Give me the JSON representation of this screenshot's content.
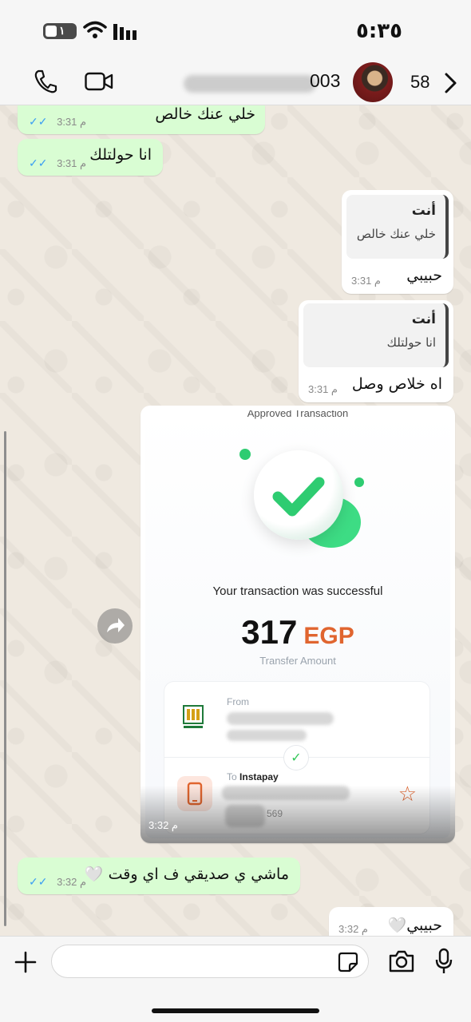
{
  "status_bar": {
    "time": "٥:٣٥",
    "battery_level": "١"
  },
  "header": {
    "contact_name_visible": "003",
    "unread_count": "58"
  },
  "messages": [
    {
      "direction": "outgoing",
      "text": "خلي عنك خالص",
      "time": "3:31 م"
    },
    {
      "direction": "outgoing",
      "text": "انا حولتلك",
      "time": "3:31 م"
    },
    {
      "direction": "incoming",
      "quote_author": "أنت",
      "quote_text": "خلي عنك خالص",
      "text": "حبيبي",
      "time": "3:31 م"
    },
    {
      "direction": "incoming",
      "quote_author": "أنت",
      "quote_text": "انا حولتلك",
      "text": "اه خلاص وصل",
      "time": "3:31 م"
    },
    {
      "direction": "outgoing",
      "text": "ماشي ي صديقي ف اي وقت 🤍",
      "time": "3:32 م"
    },
    {
      "direction": "incoming",
      "text": "حبيبي🤍",
      "time": "3:32 م"
    }
  ],
  "image_message": {
    "time": "3:32 م",
    "receipt": {
      "title": "Approved Transaction",
      "status_text": "Your transaction was successful",
      "amount": "317",
      "currency": "EGP",
      "amount_label": "Transfer Amount",
      "from_label": "From",
      "to_label": "To",
      "to_name": "Instapay",
      "account_tail": "569"
    }
  },
  "colors": {
    "outgoing_bubble": "#d9fdd3",
    "incoming_bubble": "#ffffff",
    "read_ticks": "#3b9ff3",
    "currency_accent": "#e0652f",
    "success_green": "#2ecc71"
  },
  "icons": {
    "call": "phone-icon",
    "video": "video-camera-icon",
    "back": "chevron-right-icon",
    "attach": "plus-icon",
    "sticker": "sticker-icon",
    "camera": "camera-icon",
    "mic": "microphone-icon",
    "forward": "forward-arrow-icon"
  }
}
